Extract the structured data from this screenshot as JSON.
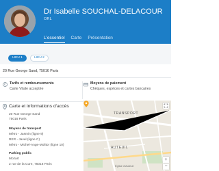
{
  "header": {
    "doctor_name": "Dr Isabelle SOUCHAL-DELACOUR",
    "specialty": "ORL",
    "tabs": [
      {
        "label": "L'essentiel",
        "active": true
      },
      {
        "label": "Carte",
        "active": false
      },
      {
        "label": "Présentation",
        "active": false
      }
    ],
    "brand_color": "#1c7ec7"
  },
  "lieux": {
    "lieu1": "LIEU 1",
    "lieu2": "LIEU 2"
  },
  "address": "20 Rue George Sand, 75016 Paris",
  "tarifs": {
    "title": "Tarifs et remboursements",
    "text": "Carte Vitale acceptée",
    "icon": "euro-icon"
  },
  "paiement": {
    "title": "Moyens de paiement",
    "text": "Chèques, espèces et cartes bancaires",
    "icon": "card-icon"
  },
  "card": {
    "title": "Carte et informations d'accès",
    "icon": "map-pin-icon",
    "address": "20 Rue George Sand",
    "city": "75016 Paris",
    "transport_title": "Moyens de transport",
    "transport": [
      "Métro - Jasmin (ligne 9)",
      "RER - Javel (ligne C)",
      "Métro - Michel-Ange-Molitor (ligne 10)"
    ],
    "parking_title": "Parking public",
    "parking": [
      "Mozart",
      "2 rue de la Cure, 75016 Paris"
    ]
  },
  "map": {
    "labels": [
      "TRANSPORT",
      "AUTEUIL",
      "Église d'Auteuil"
    ],
    "zoom_in": "+",
    "zoom_out": "−"
  }
}
